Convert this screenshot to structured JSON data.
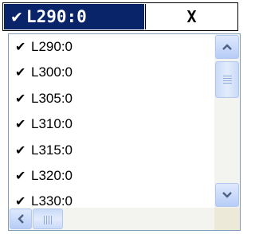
{
  "header": {
    "selected_check": "✔",
    "selected_value": "L290:0",
    "clear_label": "X"
  },
  "list": {
    "items": [
      {
        "check": "✔",
        "label": "L290:0"
      },
      {
        "check": "✔",
        "label": "L300:0"
      },
      {
        "check": "✔",
        "label": "L305:0"
      },
      {
        "check": "✔",
        "label": "L310:0"
      },
      {
        "check": "✔",
        "label": "L315:0"
      },
      {
        "check": "✔",
        "label": "L320:0"
      },
      {
        "check": "✔",
        "label": "L330:0"
      }
    ]
  },
  "icons": {
    "scroll_up": "chevron-up-icon",
    "scroll_down": "chevron-down-icon",
    "scroll_left": "chevron-left-icon"
  },
  "colors": {
    "header_bg": "#0a246a",
    "scrollbar_accent": "#4d6185"
  }
}
